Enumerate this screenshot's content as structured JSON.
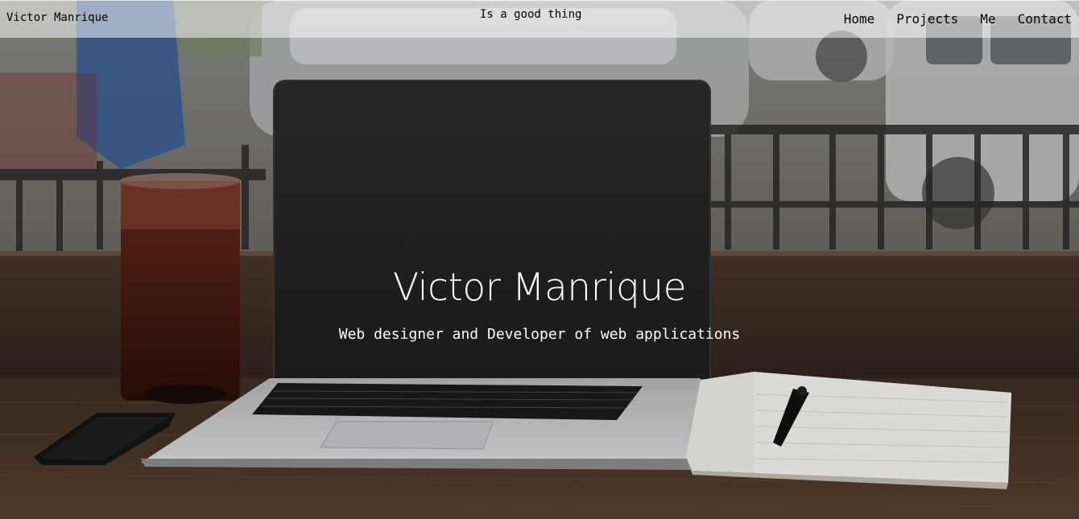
{
  "header": {
    "brand": "Victor Manrique",
    "tagline": "Is a good thing",
    "nav": [
      {
        "label": "Home"
      },
      {
        "label": "Projects"
      },
      {
        "label": "Me"
      },
      {
        "label": "Contact"
      }
    ]
  },
  "hero": {
    "title": "Victor Manrique",
    "subtitle": "Web designer and Developer of web applications",
    "background_icon": "laptop-desk-photo"
  },
  "colors": {
    "nav_bg": "#ffffffcc",
    "text_dark": "#000000",
    "text_light": "#ffffff"
  }
}
